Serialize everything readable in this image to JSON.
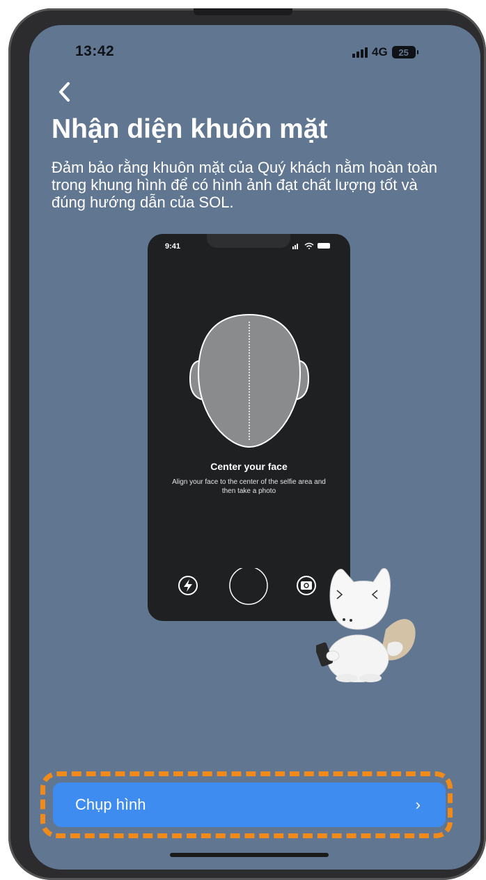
{
  "status_bar": {
    "time": "13:42",
    "network": "4G",
    "battery": "25"
  },
  "header": {
    "back_icon": "chevron-left-icon",
    "title": "Nhận diện khuôn mặt",
    "description": "Đảm bảo rằng khuôn mặt của Quý khách nằm hoàn toàn trong khung hình để có hình ảnh đạt chất lượng tốt và đúng hướng dẫn của SOL."
  },
  "illustration": {
    "time": "9:41",
    "heading": "Center your face",
    "subtitle": "Align your face to the center of the selfie area and then take a photo",
    "icons": [
      "flash-icon",
      "shutter-icon",
      "switch-camera-icon"
    ]
  },
  "action": {
    "label": "Chụp hình",
    "chevron": "›"
  },
  "colors": {
    "background": "#617690",
    "button": "#3f8cf0",
    "highlight": "#f08a1b"
  }
}
